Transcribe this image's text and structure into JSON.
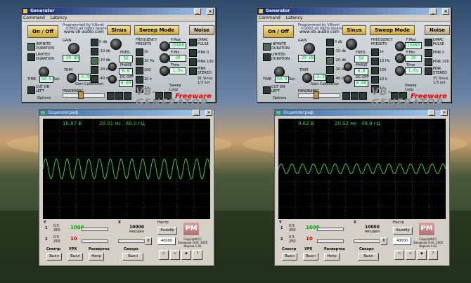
{
  "panes": [
    {
      "generator": {
        "title": "Generator",
        "menu": [
          "Command",
          "Latency"
        ],
        "credit1": "Programmed by V.Burel",
        "credit2": "©2002 all rights reserved",
        "url": "www.vb-audio.com",
        "onoff": "On / Off",
        "infinite": "INFINITE DURATION",
        "limited": "LIMITED DURATION",
        "time_label": "TIME",
        "time_value": "50.0",
        "time_unit": "Sec",
        "cut": "CUT ON LEFT",
        "options": "Options",
        "gain_label": "GAIN",
        "gain_value": "-20 db",
        "db_levels": [
          "0 db",
          "-10 db",
          "-20 db",
          "-30 db",
          "-40 db"
        ],
        "trim": "TRIM",
        "trim_value": "-5.30",
        "gain_cal": "Gain Calibration",
        "panoramic": "PANORAMIC",
        "sinus": "Sinus",
        "freq_label": "FREQ.",
        "freq_value": "50",
        "phase_label": "PHASE",
        "phase_value": "0.0",
        "dcoff_label": "DC-OFF",
        "dcoff_value": "0.00",
        "sweep": "Sweep Mode",
        "presets": "FREQUENCY PRESETS",
        "preset_vals": [
          "1k",
          "10 Hz",
          "100",
          "10 k",
          "1 k",
          "20k"
        ],
        "fmax_label": "F.Max",
        "fmax_value": "15000",
        "fmin_label": "F.Min",
        "fmin_value": "20",
        "time2_label": "Time",
        "time2_value": "1.0s",
        "sweep_loop": "Sweep Loop",
        "noise": "Noise",
        "dirac": "DIRAC PULSE",
        "pink0": "PINK 0",
        "pink100": "PINK 100",
        "pinkst": "PINK STEREO",
        "sinus31": "31 Sinus",
        "oct": "1/3 oct",
        "brand": "VB-GENERATOR",
        "freeware": "Freeware"
      },
      "scope": {
        "title": "Осциллограф",
        "voltage": "16.87 В",
        "time": "20.01 мс",
        "freq": "60.0 гЦ",
        "amplitude": 1,
        "y_label": "Y",
        "x_label": "X",
        "ch1_num": "1",
        "ch2_num": "2",
        "scale1": "0.5",
        "scale2": "250",
        "val1000": "1000",
        "val10": "10",
        "val10000": "10000",
        "us_div": "мкс/дел",
        "setup": "Настр",
        "calib": "Калибр",
        "sel_value": "40000",
        "spectr": "Спектр",
        "uhi": "УРХ",
        "razv": "Развертка",
        "sync": "Синхро",
        "off": "Выкл",
        "nepr": "Непр",
        "pm": "PM",
        "copyright": "Copyright(C) Зиновьев О.Ю. 2005 Версия 1.02",
        "b8": "8",
        "help": "?"
      }
    },
    {
      "generator": {
        "title": "Generator",
        "menu": [
          "Command",
          "Latency"
        ],
        "credit1": "Programmed by V.Burel",
        "credit2": "©2002 all rights reserved",
        "url": "www.vb-audio.com",
        "onoff": "On / Off",
        "infinite": "INFINITE DURATION",
        "limited": "LIMITED DURATION",
        "time_label": "TIME",
        "time_value": "50.0",
        "time_unit": "Sec",
        "cut": "CUT ON LEFT",
        "options": "Options",
        "gain_label": "GAIN",
        "gain_value": "-20 db",
        "db_levels": [
          "0 db",
          "-10 db",
          "-20 db",
          "-30 db",
          "-40 db"
        ],
        "trim": "TRIM",
        "trim_value": "-5.30",
        "gain_cal": "Gain Calibration",
        "panoramic": "PANORAMIC",
        "sinus": "Sinus",
        "freq_label": "FREQ.",
        "freq_value": "50",
        "phase_label": "PHASE",
        "phase_value": "0.0",
        "dcoff_label": "DC-OFF",
        "dcoff_value": "0.00",
        "sweep": "Sweep Mode",
        "presets": "FREQUENCY PRESETS",
        "preset_vals": [
          "1k",
          "10 Hz",
          "100",
          "10 k",
          "1 k",
          "20k"
        ],
        "fmax_label": "F.Max",
        "fmax_value": "15000",
        "fmin_label": "F.Min",
        "fmin_value": "20",
        "time2_label": "Time",
        "time2_value": "1.0s",
        "sweep_loop": "Sweep Loop",
        "noise": "Noise",
        "dirac": "DIRAC PULSE",
        "pink0": "PINK 0",
        "pink100": "PINK 100",
        "pinkst": "PINK STEREO",
        "sinus31": "31 Sinus",
        "oct": "1/3 oct",
        "brand": "VB-GENERATOR",
        "freeware": "Freeware"
      },
      "scope": {
        "title": "Осциллограф",
        "voltage": "9.62 В",
        "time": "20.02 мс",
        "freq": "49.9 гЦ",
        "amplitude": 0.5,
        "y_label": "Y",
        "x_label": "X",
        "ch1_num": "1",
        "ch2_num": "2",
        "scale1": "0.5",
        "scale2": "250",
        "val1000": "1000",
        "val10": "10",
        "val10000": "10000",
        "us_div": "мкс/дел",
        "setup": "Настр",
        "calib": "Калибр",
        "sel_value": "40000",
        "spectr": "Спектр",
        "uhi": "УРХ",
        "razv": "Развертка",
        "sync": "Синхро",
        "off": "Выкл",
        "nepr": "Непр",
        "pm": "PM",
        "copyright": "Copyright(C) Зиновьев О.Ю. 2005 Версия 1.02",
        "b8": "8",
        "help": "?"
      }
    }
  ]
}
